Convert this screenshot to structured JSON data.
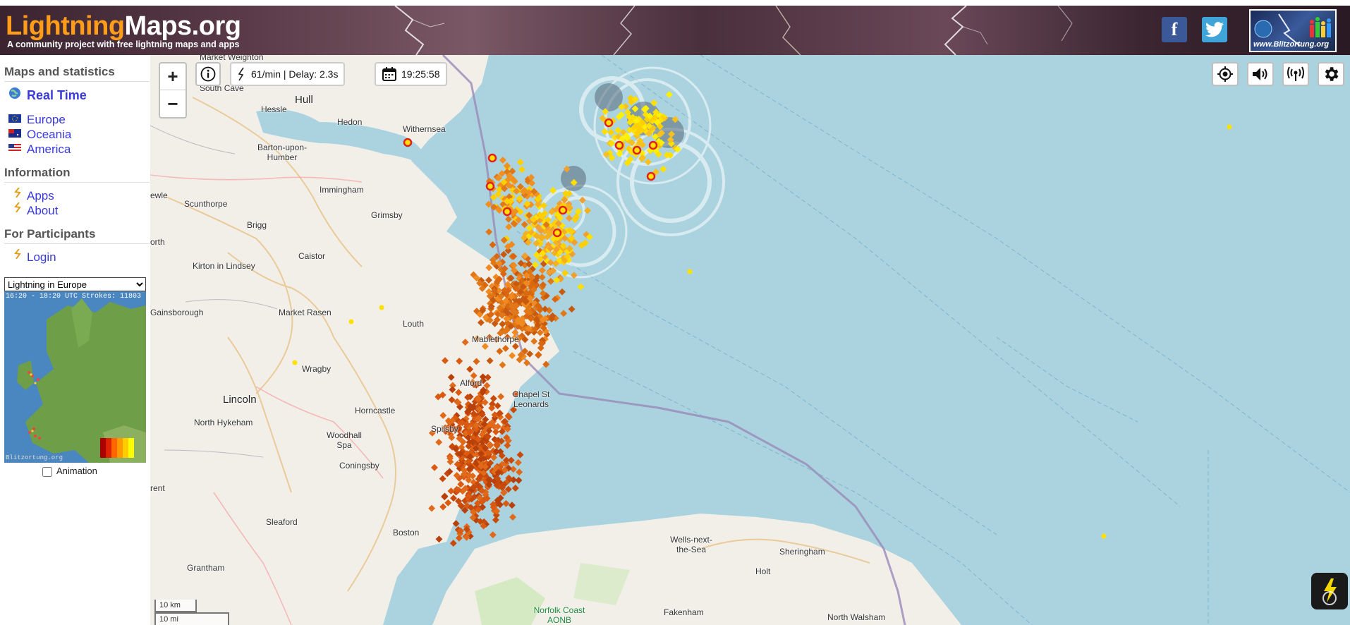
{
  "header": {
    "logo_part1": "Lightning",
    "logo_part2": "Maps.org",
    "tagline": "A community project with free lightning maps and apps",
    "facebook_label": "f",
    "blitzortung_label": "www.Blitzortung.org"
  },
  "sidebar": {
    "maps_heading": "Maps and statistics",
    "realtime_label": "Real Time",
    "regions": [
      "Europe",
      "Oceania",
      "America"
    ],
    "info_heading": "Information",
    "info_links": [
      "Apps",
      "About"
    ],
    "participants_heading": "For Participants",
    "login_label": "Login",
    "select_value": "Lightning in Europe",
    "thumbnail_caption": "16:20 - 18:20 UTC Strokes: 11803",
    "thumbnail_footer": "Blitzortung.org",
    "animation_label": "Animation"
  },
  "map": {
    "zoom_in": "+",
    "zoom_out": "−",
    "stats_text": "61/min | Delay: 2.3s",
    "time_text": "19:25:58",
    "scale_km": "10 km",
    "scale_mi": "10 mi",
    "places": [
      "Market Weighton",
      "South Cave",
      "Hull",
      "Hessle",
      "Hedon",
      "Withernsea",
      "Barton-upon-Humber",
      "Immingham",
      "Scunthorpe",
      "Brigg",
      "Grimsby",
      "Caistor",
      "Kirton in Lindsey",
      "Market Rasen",
      "Louth",
      "Mablethorpe",
      "Wragby",
      "Alford",
      "Chapel St Leonards",
      "Lincoln",
      "Horncastle",
      "Spilsby",
      "North Hykeham",
      "Woodhall Spa",
      "Coningsby",
      "Sleaford",
      "Boston",
      "Grantham",
      "Wells-next-the-Sea",
      "Sheringham",
      "Holt",
      "Fakenham",
      "North Walsham",
      "Norfolk Coast AONB",
      "Gainsborough",
      "orth",
      "ewle",
      "rent"
    ]
  },
  "colors": {
    "sea": "#aad3df",
    "land": "#f2efe9",
    "accent_link": "#3a3adb",
    "logo_orange": "#ff9d1a"
  },
  "icons": [
    "info-icon",
    "lightning-bolt-icon",
    "calendar-icon",
    "locate-icon",
    "sound-icon",
    "signal-icon",
    "gear-icon",
    "app-fab-icon"
  ]
}
